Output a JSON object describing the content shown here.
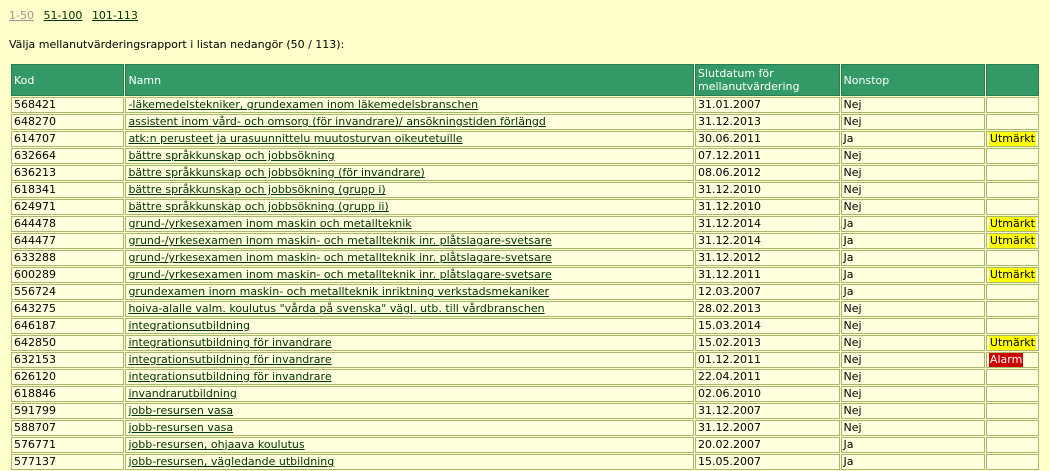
{
  "pager": {
    "current": "1-50",
    "links": [
      "51-100",
      "101-113"
    ]
  },
  "intro": "Välja mellanutvärderingsrapport i listan nedangör (50 / 113):",
  "table": {
    "headers": [
      "Kod",
      "Namn",
      "Slutdatum för mellanutvärdering",
      "Nonstop",
      ""
    ],
    "rows": [
      {
        "kod": "568421",
        "namn": "-läkemedelstekniker, grundexamen inom läkemedelsbranschen",
        "datum": "31.01.2007",
        "nonstop": "Nej",
        "status": ""
      },
      {
        "kod": "648270",
        "namn": "assistent inom vård- och omsorg (för invandrare)/ ansökningstiden förlängd",
        "datum": "31.12.2013",
        "nonstop": "Nej",
        "status": ""
      },
      {
        "kod": "614707",
        "namn": "atk:n perusteet ja urasuunnittelu muutosturvan oikeutetuille",
        "datum": "30.06.2011",
        "nonstop": "Ja",
        "status": "Utmärkt"
      },
      {
        "kod": "632664",
        "namn": "bättre språkkunskap och jobbsökning",
        "datum": "07.12.2011",
        "nonstop": "Nej",
        "status": ""
      },
      {
        "kod": "636213",
        "namn": "bättre språkkunskap och jobbsökning (för invandrare)",
        "datum": "08.06.2012",
        "nonstop": "Nej",
        "status": ""
      },
      {
        "kod": "618341",
        "namn": "bättre språkkunskap och jobbsökning (grupp i)",
        "datum": "31.12.2010",
        "nonstop": "Nej",
        "status": ""
      },
      {
        "kod": "624971",
        "namn": "bättre språkkunskap och jobbsökning (grupp ii)",
        "datum": "31.12.2010",
        "nonstop": "Nej",
        "status": ""
      },
      {
        "kod": "644478",
        "namn": "grund-/yrkesexamen inom maskin och metallteknik",
        "datum": "31.12.2014",
        "nonstop": "Ja",
        "status": "Utmärkt"
      },
      {
        "kod": "644477",
        "namn": "grund-/yrkesexamen inom maskin- och metallteknik inr. plåtslagare-svetsare",
        "datum": "31.12.2014",
        "nonstop": "Ja",
        "status": "Utmärkt"
      },
      {
        "kod": "633288",
        "namn": "grund-/yrkesexamen inom maskin- och metallteknik inr. plåtslagare-svetsare",
        "datum": "31.12.2012",
        "nonstop": "Ja",
        "status": ""
      },
      {
        "kod": "600289",
        "namn": "grund-/yrkesexamen inom maskin- och metallteknik inr. plåtslagare-svetsare",
        "datum": "31.12.2011",
        "nonstop": "Ja",
        "status": "Utmärkt"
      },
      {
        "kod": "556724",
        "namn": "grundexamen inom maskin- och metallteknik inriktning verkstadsmekaniker",
        "datum": "12.03.2007",
        "nonstop": "Ja",
        "status": ""
      },
      {
        "kod": "643275",
        "namn": "hoiva-alalle valm. koulutus \"vårda på svenska\" vägl. utb. till vårdbranschen",
        "datum": "28.02.2013",
        "nonstop": "Nej",
        "status": ""
      },
      {
        "kod": "646187",
        "namn": "integrationsutbildning",
        "datum": "15.03.2014",
        "nonstop": "Nej",
        "status": ""
      },
      {
        "kod": "642850",
        "namn": "integrationsutbildning för invandrare",
        "datum": "15.02.2013",
        "nonstop": "Nej",
        "status": "Utmärkt"
      },
      {
        "kod": "632153",
        "namn": "integrationsutbildning för invandrare",
        "datum": "01.12.2011",
        "nonstop": "Nej",
        "status": "Alarm"
      },
      {
        "kod": "626120",
        "namn": "integrationsutbildning för invandrare",
        "datum": "22.04.2011",
        "nonstop": "Nej",
        "status": ""
      },
      {
        "kod": "618846",
        "namn": "invandrarutbildning",
        "datum": "02.06.2010",
        "nonstop": "Nej",
        "status": ""
      },
      {
        "kod": "591799",
        "namn": "jobb-resursen vasa",
        "datum": "31.12.2007",
        "nonstop": "Nej",
        "status": ""
      },
      {
        "kod": "588707",
        "namn": "jobb-resursen vasa",
        "datum": "31.12.2007",
        "nonstop": "Nej",
        "status": ""
      },
      {
        "kod": "576771",
        "namn": "jobb-resursen, ohjaava koulutus",
        "datum": "20.02.2007",
        "nonstop": "Ja",
        "status": ""
      },
      {
        "kod": "577137",
        "namn": "jobb-resursen, vägledande utbildning",
        "datum": "15.05.2007",
        "nonstop": "Ja",
        "status": ""
      }
    ]
  },
  "colors": {
    "page_bg": "#ffffcc",
    "header_bg": "#339966",
    "utmarkt": "#ffff00",
    "alarm": "#cc0000"
  }
}
